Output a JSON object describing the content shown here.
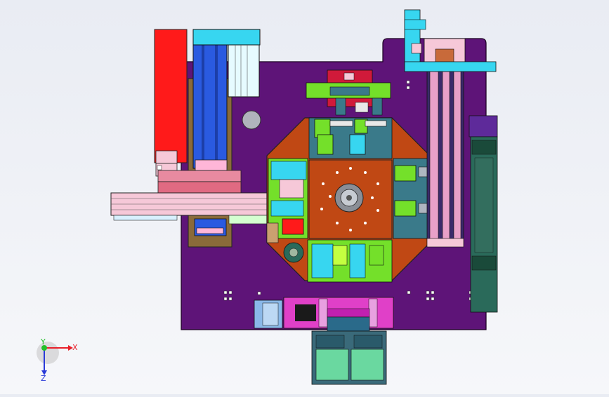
{
  "triad": {
    "x_label": "X",
    "y_label": "Y",
    "z_label": "Z",
    "colors": {
      "x": "#e8202a",
      "y": "#22c02a",
      "z": "#2a3ad8"
    }
  },
  "colors": {
    "background": "#eef0f5",
    "base_plate": "#5e1478",
    "dial_table": "#c04814",
    "accent_red": "#ff1a1a",
    "accent_blue": "#2a5ae0",
    "accent_cyan": "#37d6f0",
    "accent_green": "#74e02a",
    "accent_pink": "#f6c8d8",
    "accent_teal": "#2a6a5a"
  }
}
